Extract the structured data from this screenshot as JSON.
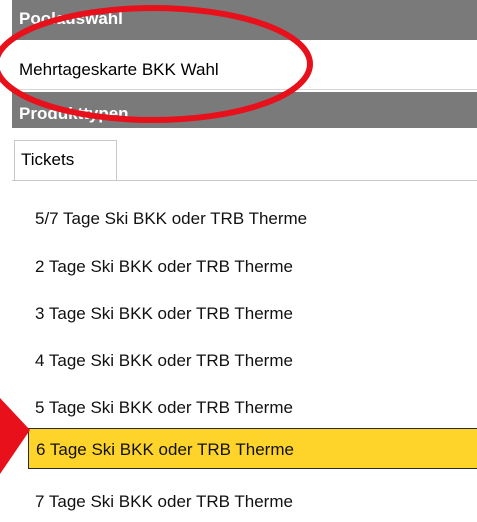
{
  "pool": {
    "header": "Poolauswahl",
    "value": "Mehrtageskarte BKK Wahl"
  },
  "product_types": {
    "header": "Produkttypen",
    "tabs": [
      {
        "label": "Tickets"
      }
    ]
  },
  "tickets": [
    {
      "label": "5/7 Tage Ski BKK oder TRB Therme",
      "selected": false
    },
    {
      "label": "2 Tage Ski BKK oder TRB Therme",
      "selected": false
    },
    {
      "label": "3 Tage Ski BKK oder TRB Therme",
      "selected": false
    },
    {
      "label": "4 Tage Ski BKK oder TRB Therme",
      "selected": false
    },
    {
      "label": "5 Tage Ski BKK oder TRB Therme",
      "selected": false
    },
    {
      "label": "6 Tage Ski BKK oder TRB Therme",
      "selected": true
    },
    {
      "label": "7 Tage Ski BKK oder TRB Therme",
      "selected": false
    }
  ],
  "colors": {
    "header_bg": "#7a7a7a",
    "selected_bg": "#ffd42a",
    "annotation_red": "#e8101a"
  }
}
